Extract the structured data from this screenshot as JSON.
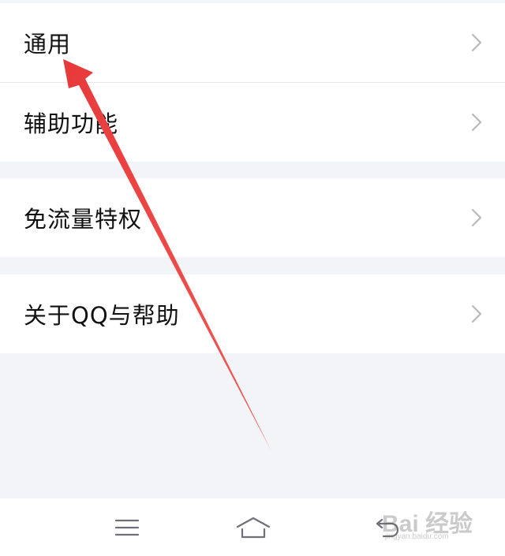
{
  "settings_list": {
    "groups": [
      {
        "items": [
          {
            "label": "通用",
            "icon": "chevron-right-icon"
          },
          {
            "label": "辅助功能",
            "icon": "chevron-right-icon"
          }
        ]
      },
      {
        "items": [
          {
            "label": "免流量特权",
            "icon": "chevron-right-icon"
          }
        ]
      },
      {
        "items": [
          {
            "label": "关于QQ与帮助",
            "icon": "chevron-right-icon"
          }
        ]
      }
    ]
  },
  "nav_bar": {
    "buttons": [
      {
        "name": "menu",
        "icon": "menu-icon"
      },
      {
        "name": "home",
        "icon": "home-icon"
      },
      {
        "name": "back",
        "icon": "back-icon"
      }
    ]
  },
  "annotation": {
    "arrow_color": "#e8393a",
    "points_to": "通用"
  },
  "watermark": {
    "logo_text": "Bai 经验",
    "url_text": "jingyan.baidu.com"
  },
  "colors": {
    "background": "#f3f4f8",
    "row_background": "#ffffff",
    "text": "#111111",
    "chevron": "#b8b8bc"
  }
}
